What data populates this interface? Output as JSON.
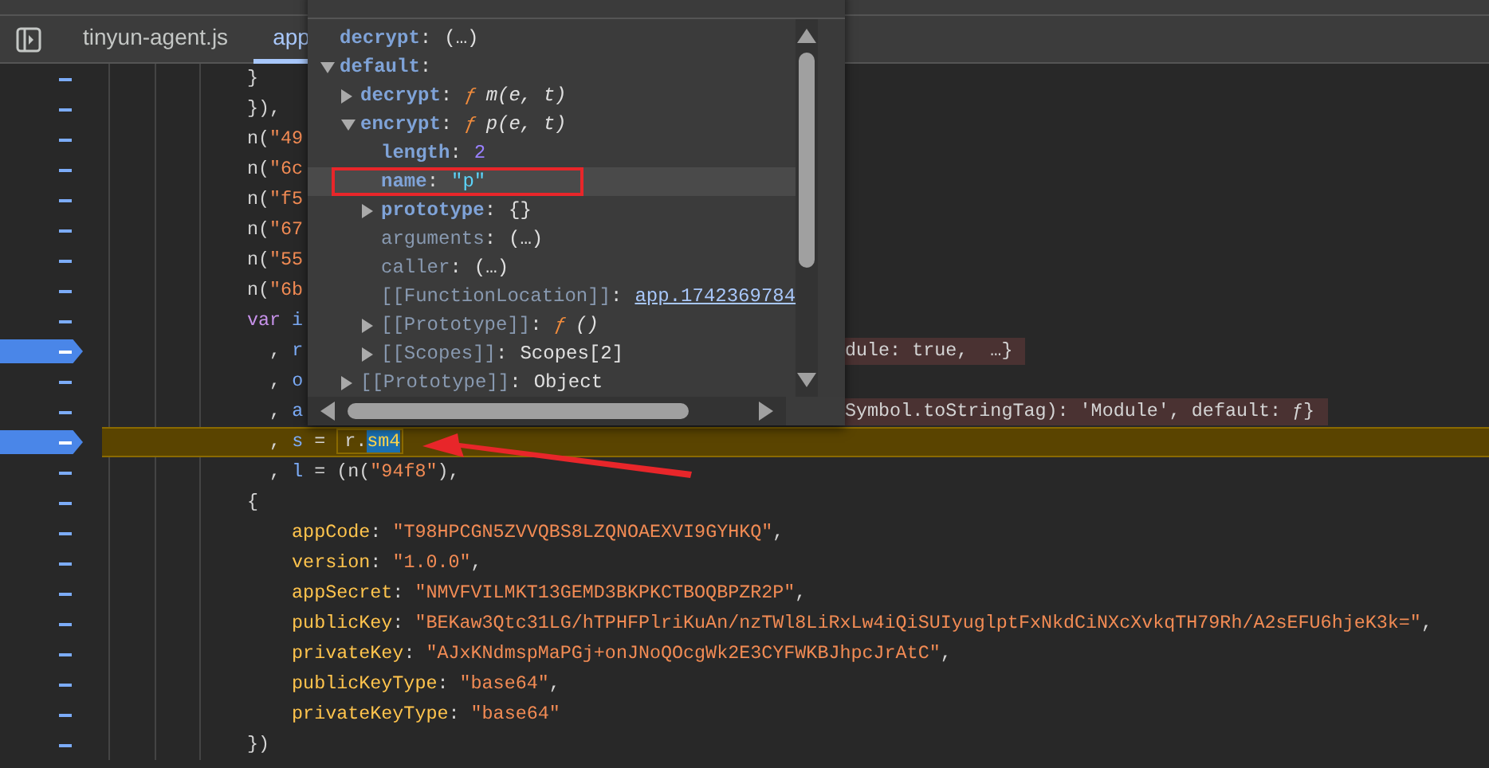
{
  "tabs": [
    {
      "label": "tinyun-agent.js",
      "selected": false
    },
    {
      "label": "app",
      "selected": true
    }
  ],
  "code_lines": [
    {
      "breakpoint": false,
      "paused": false,
      "tokens": [
        {
          "kind": "plain",
          "text": "}"
        }
      ]
    },
    {
      "breakpoint": false,
      "paused": false,
      "tokens": [
        {
          "kind": "plain",
          "text": "}),"
        }
      ]
    },
    {
      "breakpoint": false,
      "paused": false,
      "tokens": [
        {
          "kind": "plain",
          "text": "n("
        },
        {
          "kind": "string",
          "text": "\"49"
        }
      ]
    },
    {
      "breakpoint": false,
      "paused": false,
      "tokens": [
        {
          "kind": "plain",
          "text": "n("
        },
        {
          "kind": "string",
          "text": "\"6c"
        }
      ]
    },
    {
      "breakpoint": false,
      "paused": false,
      "tokens": [
        {
          "kind": "plain",
          "text": "n("
        },
        {
          "kind": "string",
          "text": "\"f5"
        }
      ]
    },
    {
      "breakpoint": false,
      "paused": false,
      "tokens": [
        {
          "kind": "plain",
          "text": "n("
        },
        {
          "kind": "string",
          "text": "\"67"
        }
      ]
    },
    {
      "breakpoint": false,
      "paused": false,
      "tokens": [
        {
          "kind": "plain",
          "text": "n("
        },
        {
          "kind": "string",
          "text": "\"55"
        }
      ]
    },
    {
      "breakpoint": false,
      "paused": false,
      "tokens": [
        {
          "kind": "plain",
          "text": "n("
        },
        {
          "kind": "string",
          "text": "\"6b"
        }
      ]
    },
    {
      "breakpoint": false,
      "paused": false,
      "tokens": [
        {
          "kind": "keyword",
          "text": "var"
        },
        {
          "kind": "ident",
          "text": " i"
        }
      ]
    },
    {
      "breakpoint": true,
      "paused": false,
      "tokens": [
        {
          "kind": "plain",
          "text": "  , "
        },
        {
          "kind": "ident",
          "text": "r"
        }
      ],
      "inline_value": "dule: true,  …}"
    },
    {
      "breakpoint": false,
      "paused": false,
      "tokens": [
        {
          "kind": "plain",
          "text": "  , "
        },
        {
          "kind": "ident",
          "text": "o"
        }
      ]
    },
    {
      "breakpoint": false,
      "paused": false,
      "tokens": [
        {
          "kind": "plain",
          "text": "  , "
        },
        {
          "kind": "ident",
          "text": "a"
        }
      ],
      "inline_value": "Symbol.toStringTag): 'Module', default: ƒ}"
    },
    {
      "breakpoint": true,
      "paused": true,
      "tokens": [
        {
          "kind": "plain",
          "text": "  , "
        },
        {
          "kind": "ident",
          "text": "s"
        },
        {
          "kind": "plain",
          "text": " = "
        }
      ],
      "hover": {
        "text": "r.",
        "selection": "sm4"
      }
    },
    {
      "breakpoint": false,
      "paused": false,
      "tokens": [
        {
          "kind": "plain",
          "text": "  , "
        },
        {
          "kind": "ident",
          "text": "l"
        },
        {
          "kind": "plain",
          "text": " = (n("
        },
        {
          "kind": "string",
          "text": "\"94f8\""
        },
        {
          "kind": "plain",
          "text": "),"
        }
      ]
    },
    {
      "breakpoint": false,
      "paused": false,
      "tokens": [
        {
          "kind": "plain",
          "text": "{"
        }
      ],
      "children": [
        {
          "breakpoint": false,
          "paused": false,
          "tokens": [
            {
              "kind": "key",
              "text": "appCode"
            },
            {
              "kind": "plain",
              "text": ": "
            },
            {
              "kind": "string",
              "text": "\"T98HPCGN5ZVVQBS8LZQNOAEXVI9GYHKQ\""
            },
            {
              "kind": "plain",
              "text": ","
            }
          ]
        },
        {
          "breakpoint": false,
          "paused": false,
          "tokens": [
            {
              "kind": "key",
              "text": "version"
            },
            {
              "kind": "plain",
              "text": ": "
            },
            {
              "kind": "string",
              "text": "\"1.0.0\""
            },
            {
              "kind": "plain",
              "text": ","
            }
          ]
        },
        {
          "breakpoint": false,
          "paused": false,
          "tokens": [
            {
              "kind": "key",
              "text": "appSecret"
            },
            {
              "kind": "plain",
              "text": ": "
            },
            {
              "kind": "string",
              "text": "\"NMVFVILMKT13GEMD3BKPKCTBOQBPZR2P\""
            },
            {
              "kind": "plain",
              "text": ","
            }
          ]
        },
        {
          "breakpoint": false,
          "paused": false,
          "tokens": [
            {
              "kind": "key",
              "text": "publicKey"
            },
            {
              "kind": "plain",
              "text": ": "
            },
            {
              "kind": "string",
              "text": "\"BEKaw3Qtc31LG/hTPHFPlriKuAn/nzTWl8LiRxLw4iQiSUIyuglptFxNkdCiNXcXvkqTH79Rh/A2sEFU6hjeK3k=\""
            },
            {
              "kind": "plain",
              "text": ","
            }
          ]
        },
        {
          "breakpoint": false,
          "paused": false,
          "tokens": [
            {
              "kind": "key",
              "text": "privateKey"
            },
            {
              "kind": "plain",
              "text": ": "
            },
            {
              "kind": "string",
              "text": "\"AJxKNdmspMaPGj+onJNoQOcgWk2E3CYFWKBJhpcJrAtC\""
            },
            {
              "kind": "plain",
              "text": ","
            }
          ]
        },
        {
          "breakpoint": false,
          "paused": false,
          "tokens": [
            {
              "kind": "key",
              "text": "publicKeyType"
            },
            {
              "kind": "plain",
              "text": ": "
            },
            {
              "kind": "string",
              "text": "\"base64\""
            },
            {
              "kind": "plain",
              "text": ","
            }
          ]
        },
        {
          "breakpoint": false,
          "paused": false,
          "tokens": [
            {
              "kind": "key",
              "text": "privateKeyType"
            },
            {
              "kind": "plain",
              "text": ": "
            },
            {
              "kind": "string",
              "text": "\"base64\""
            }
          ]
        }
      ]
    },
    {
      "breakpoint": false,
      "paused": false,
      "tokens": [
        {
          "kind": "plain",
          "text": "})"
        }
      ]
    }
  ],
  "popover": {
    "properties": [
      {
        "key": "decrypt",
        "value": [
          {
            "kind": "punct",
            "text": ":"
          },
          {
            "kind": "lazy",
            "text": "(…)"
          }
        ],
        "internal": false,
        "selected": false
      },
      {
        "key": "default",
        "value": [
          {
            "kind": "punct",
            "text": ":"
          }
        ],
        "internal": false,
        "selected": false,
        "expanded": true,
        "children": [
          {
            "key": "decrypt",
            "value": [
              {
                "kind": "punct",
                "text": ":"
              },
              {
                "kind": "func",
                "text": "ƒ"
              },
              {
                "kind": "signature",
                "text": "m(e, t)"
              }
            ],
            "internal": false,
            "selected": false,
            "expanded": false
          },
          {
            "key": "encrypt",
            "value": [
              {
                "kind": "punct",
                "text": ":"
              },
              {
                "kind": "func",
                "text": "ƒ"
              },
              {
                "kind": "signature",
                "text": "p(e, t)"
              }
            ],
            "internal": false,
            "selected": false,
            "expanded": true,
            "children": [
              {
                "key": "length",
                "value": [
                  {
                    "kind": "punct",
                    "text": ":"
                  },
                  {
                    "kind": "number",
                    "text": "2"
                  }
                ],
                "internal": false,
                "selected": false
              },
              {
                "key": "name",
                "value": [
                  {
                    "kind": "punct",
                    "text": ":"
                  },
                  {
                    "kind": "string",
                    "text": "\"p\""
                  }
                ],
                "internal": false,
                "selected": true
              },
              {
                "key": "prototype",
                "value": [
                  {
                    "kind": "punct",
                    "text": ":"
                  },
                  {
                    "kind": "plain",
                    "text": "{}"
                  }
                ],
                "internal": false,
                "selected": false,
                "expanded": false
              },
              {
                "key": "arguments",
                "value": [
                  {
                    "kind": "punct",
                    "text": ":"
                  },
                  {
                    "kind": "lazy",
                    "text": "(…)"
                  }
                ],
                "internal": true,
                "selected": false
              },
              {
                "key": "caller",
                "value": [
                  {
                    "kind": "punct",
                    "text": ":"
                  },
                  {
                    "kind": "lazy",
                    "text": "(…)"
                  }
                ],
                "internal": true,
                "selected": false
              },
              {
                "key": "[[FunctionLocation]]",
                "value": [
                  {
                    "kind": "punct",
                    "text": ":"
                  },
                  {
                    "kind": "link",
                    "text": "app.1742369784"
                  }
                ],
                "internal": true,
                "selected": false
              },
              {
                "key": "[[Prototype]]",
                "value": [
                  {
                    "kind": "punct",
                    "text": ":"
                  },
                  {
                    "kind": "func",
                    "text": "ƒ"
                  },
                  {
                    "kind": "signature",
                    "text": "()"
                  }
                ],
                "internal": true,
                "selected": false,
                "expanded": false
              },
              {
                "key": "[[Scopes]]",
                "value": [
                  {
                    "kind": "punct",
                    "text": ":"
                  },
                  {
                    "kind": "plain",
                    "text": "Scopes[2]"
                  }
                ],
                "internal": true,
                "selected": false,
                "expanded": false
              }
            ]
          },
          {
            "key": "[[Prototype]]",
            "value": [
              {
                "kind": "punct",
                "text": ":"
              },
              {
                "kind": "plain",
                "text": "Object"
              }
            ],
            "internal": true,
            "selected": false,
            "expanded": false
          }
        ]
      }
    ]
  }
}
